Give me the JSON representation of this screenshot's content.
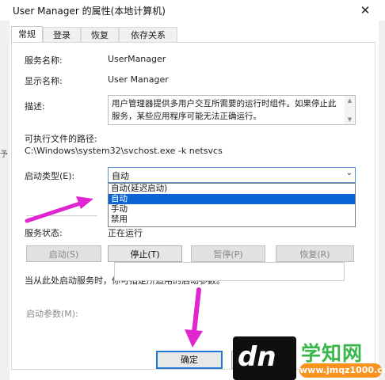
{
  "window": {
    "title": "User Manager 的属性(本地计算机)",
    "close_glyph": "✕"
  },
  "tabs": [
    {
      "label": "常规",
      "active": true
    },
    {
      "label": "登录",
      "active": false
    },
    {
      "label": "恢复",
      "active": false
    },
    {
      "label": "依存关系",
      "active": false
    }
  ],
  "general": {
    "service_name_label": "服务名称:",
    "service_name_value": "UserManager",
    "display_name_label": "显示名称:",
    "display_name_value": "User Manager",
    "description_label": "描述:",
    "description_value": "用户管理器提供多用户交互所需要的运行时组件。如果停止此服务，某些应用程序可能无法正确运行。",
    "exe_path_label": "可执行文件的路径:",
    "exe_path_value": "C:\\Windows\\system32\\svchost.exe -k netsvcs",
    "startup_type_label": "启动类型(E):",
    "startup_type_value": "自动",
    "startup_type_options": [
      "自动(延迟启动)",
      "自动",
      "手动",
      "禁用"
    ],
    "startup_type_highlighted": "自动",
    "service_status_label": "服务状态:",
    "service_status_value": "正在运行",
    "start_button": "启动(S)",
    "stop_button": "停止(T)",
    "pause_button": "暂停(P)",
    "resume_button": "恢复(R)",
    "hint_text": "当从此处启动服务时，你可指定所适用的启动参数。",
    "start_params_label": "启动参数(M):",
    "start_params_value": ""
  },
  "footer": {
    "ok_button": "确定"
  },
  "watermark": {
    "logo": "dn",
    "site_name": "学知网",
    "url": "www.jmqz1000.com"
  },
  "colors": {
    "accent": "#0a64d6",
    "arrow": "#e026d0",
    "wm_green": "#39b54a",
    "wm_orange": "#f7931e"
  }
}
